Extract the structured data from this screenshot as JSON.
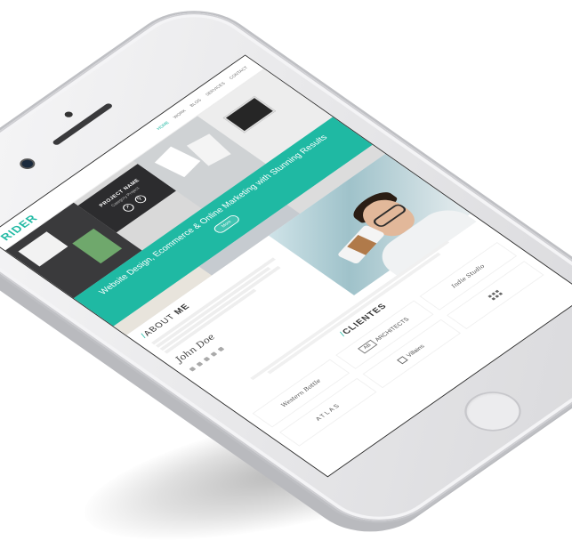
{
  "site": {
    "logo": "RIDER",
    "nav": [
      "HOME",
      "WORK",
      "BLOG",
      "SERVICES",
      "CONTACT"
    ]
  },
  "hero": {
    "project_card_title": "PROJECT NAME",
    "project_card_subtitle": "Category Project",
    "band_title": "Website Design, Ecommerce & Online Marketing with Stunning Results",
    "band_button": "More"
  },
  "about": {
    "heading_slash": "/",
    "heading_light": "ABOUT",
    "heading_bold": "ME",
    "signature": "John Doe"
  },
  "clients": {
    "heading_slash": "/",
    "heading_bold": "CLIENTES",
    "logos": [
      "Western Bottle",
      "ARCHITECTS",
      "Indie Studio",
      "ATLAS",
      "Villains",
      ""
    ]
  },
  "colors": {
    "accent": "#1fb9a3",
    "phone_body": "#e9e9eb"
  },
  "icons": [
    "speaker-icon",
    "front-camera-icon",
    "home-button-icon",
    "play-icon"
  ]
}
